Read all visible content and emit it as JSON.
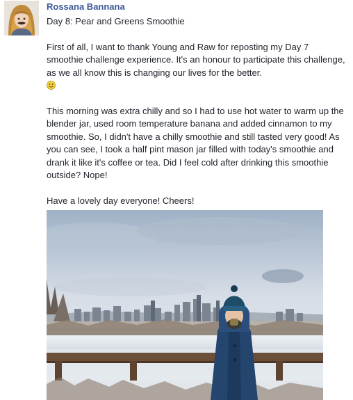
{
  "post": {
    "author": "Rossana Bannana",
    "title": "Day 8: Pear and Greens Smoothie",
    "paragraph1": "First of all, I want to thank Young and Raw for reposting my Day 7 smoothie challenge experience. It's an honour to participate this challenge, as we all know this is changing our lives for the better.",
    "paragraph1_emoji": "smile-emoji-icon",
    "paragraph2": "This morning was extra chilly and so I had to use hot water to warm up the blender jar, used room temperature banana and added cinnamon to my smoothie. So, I didn't have a chilly smoothie and still tasted very good! As you can see, I took a half pint mason jar filled with today's smoothie and drank it like it's coffee or tea. Did I feel cold after drinking this smoothie outside? Nope!",
    "paragraph3": "Have a lovely day everyone! Cheers!"
  },
  "colors": {
    "author_link": "#3b5998",
    "text": "#1d2129",
    "emoji_face": "#f5d442"
  }
}
